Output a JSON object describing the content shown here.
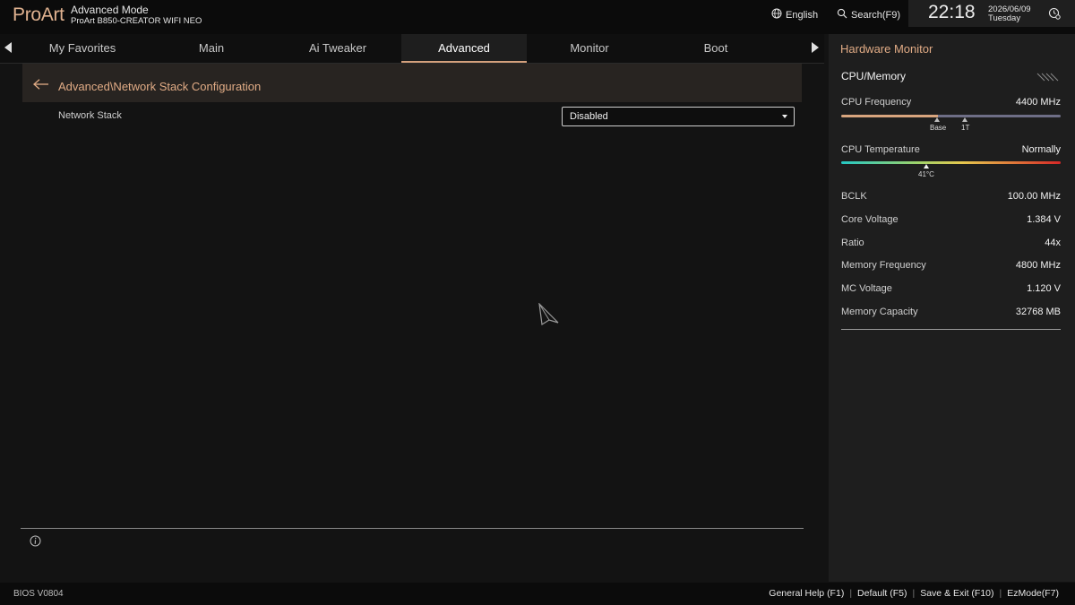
{
  "header": {
    "brand": "ProArt",
    "mode_title": "Advanced Mode",
    "model": "ProArt B850-CREATOR WIFI NEO",
    "language": "English",
    "search": "Search(F9)",
    "time": "22:18",
    "date": "2026/06/09",
    "weekday": "Tuesday"
  },
  "tabs": [
    {
      "label": "My Favorites",
      "active": false
    },
    {
      "label": "Main",
      "active": false
    },
    {
      "label": "Ai Tweaker",
      "active": false
    },
    {
      "label": "Advanced",
      "active": true
    },
    {
      "label": "Monitor",
      "active": false
    },
    {
      "label": "Boot",
      "active": false
    }
  ],
  "main": {
    "breadcrumb": "Advanced\\Network Stack Configuration",
    "settings": [
      {
        "label": "Network Stack",
        "value": "Disabled"
      }
    ]
  },
  "hardware_monitor": {
    "title": "Hardware Monitor",
    "section": "CPU/Memory",
    "cpu_frequency": {
      "label": "CPU Frequency",
      "value": "4400 MHz",
      "marker_base": "Base",
      "marker_1t": "1T"
    },
    "cpu_temperature": {
      "label": "CPU Temperature",
      "value": "Normally",
      "reading": "41°C"
    },
    "rows": [
      {
        "label": "BCLK",
        "value": "100.00 MHz"
      },
      {
        "label": "Core Voltage",
        "value": "1.384 V"
      },
      {
        "label": "Ratio",
        "value": "44x"
      },
      {
        "label": "Memory Frequency",
        "value": "4800 MHz"
      },
      {
        "label": "MC Voltage",
        "value": "1.120 V"
      },
      {
        "label": "Memory Capacity",
        "value": "32768 MB"
      }
    ]
  },
  "footer": {
    "bios_version": "BIOS V0804",
    "links": [
      "General Help (F1)",
      "Default (F5)",
      "Save & Exit (F10)",
      "EzMode(F7)"
    ]
  },
  "colors": {
    "accent": "#e0ab85",
    "background": "#131313",
    "panel": "#1e1e1e",
    "breadcrumb_bg": "#282421"
  }
}
